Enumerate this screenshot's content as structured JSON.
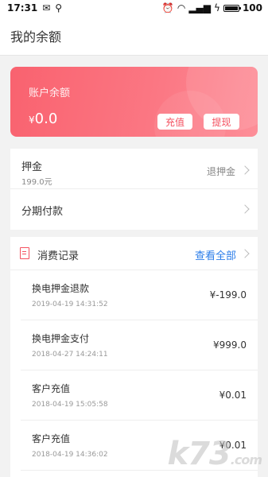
{
  "status_bar": {
    "time": "17:31",
    "battery": "100",
    "battery_level": 1.0
  },
  "header": {
    "title": "我的余额"
  },
  "balance_card": {
    "label": "账户余额",
    "currency_symbol": "¥",
    "amount": "0.0",
    "recharge_label": "充值",
    "withdraw_label": "提现"
  },
  "deposit": {
    "label": "押金",
    "value": "199.0元",
    "action": "退押金"
  },
  "installment": {
    "label": "分期付款"
  },
  "records": {
    "title": "消费记录",
    "view_all": "查看全部",
    "items": [
      {
        "title": "换电押金退款",
        "time": "2019-04-19 14:31:52",
        "amount": "¥-199.0"
      },
      {
        "title": "换电押金支付",
        "time": "2018-04-27 14:24:11",
        "amount": "¥999.0"
      },
      {
        "title": "客户充值",
        "time": "2018-04-19 15:05:58",
        "amount": "¥0.01"
      },
      {
        "title": "客户充值",
        "time": "2018-04-19 14:36:02",
        "amount": "¥0.01"
      }
    ]
  },
  "watermark": {
    "text": "k73",
    "suffix": ".com"
  },
  "colors": {
    "accent": "#f4505f",
    "link": "#2b7de9",
    "card_gradient_start": "#f9626f",
    "card_gradient_end": "#fd8e98"
  }
}
